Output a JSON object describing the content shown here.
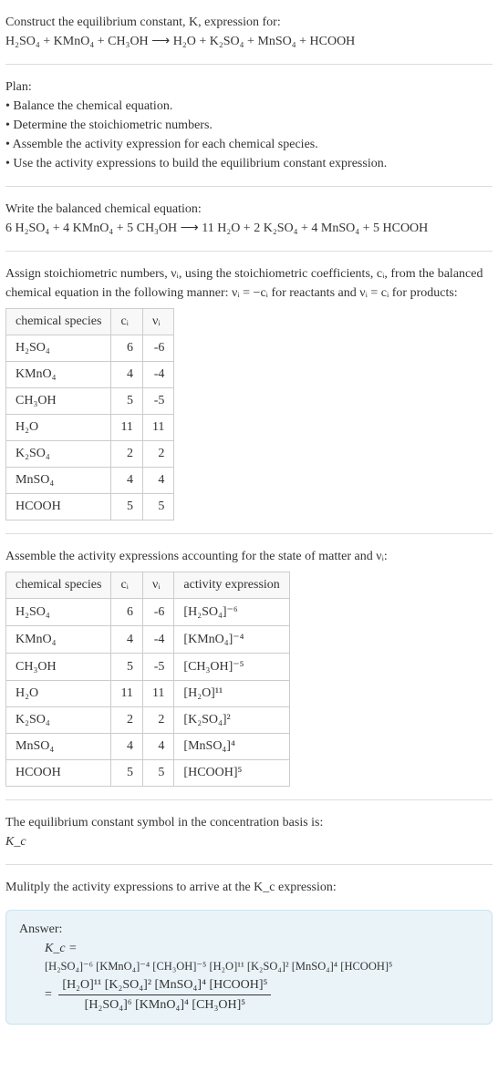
{
  "intro": {
    "prompt": "Construct the equilibrium constant, K, expression for:",
    "equation": "H₂SO₄ + KMnO₄ + CH₃OH ⟶ H₂O + K₂SO₄ + MnSO₄ + HCOOH"
  },
  "plan": {
    "heading": "Plan:",
    "bullets": [
      "• Balance the chemical equation.",
      "• Determine the stoichiometric numbers.",
      "• Assemble the activity expression for each chemical species.",
      "• Use the activity expressions to build the equilibrium constant expression."
    ]
  },
  "balanced": {
    "heading": "Write the balanced chemical equation:",
    "equation": "6 H₂SO₄ + 4 KMnO₄ + 5 CH₃OH ⟶ 11 H₂O + 2 K₂SO₄ + 4 MnSO₄ + 5 HCOOH"
  },
  "stoich": {
    "text1": "Assign stoichiometric numbers, νᵢ, using the stoichiometric coefficients, cᵢ, from the balanced chemical equation in the following manner: νᵢ = −cᵢ for reactants and νᵢ = cᵢ for products:",
    "headers": {
      "species": "chemical species",
      "ci": "cᵢ",
      "vi": "νᵢ"
    },
    "rows": [
      {
        "species": "H₂SO₄",
        "ci": "6",
        "vi": "-6"
      },
      {
        "species": "KMnO₄",
        "ci": "4",
        "vi": "-4"
      },
      {
        "species": "CH₃OH",
        "ci": "5",
        "vi": "-5"
      },
      {
        "species": "H₂O",
        "ci": "11",
        "vi": "11"
      },
      {
        "species": "K₂SO₄",
        "ci": "2",
        "vi": "2"
      },
      {
        "species": "MnSO₄",
        "ci": "4",
        "vi": "4"
      },
      {
        "species": "HCOOH",
        "ci": "5",
        "vi": "5"
      }
    ]
  },
  "activity": {
    "heading": "Assemble the activity expressions accounting for the state of matter and νᵢ:",
    "headers": {
      "species": "chemical species",
      "ci": "cᵢ",
      "vi": "νᵢ",
      "expr": "activity expression"
    },
    "rows": [
      {
        "species": "H₂SO₄",
        "ci": "6",
        "vi": "-6",
        "expr": "[H₂SO₄]⁻⁶"
      },
      {
        "species": "KMnO₄",
        "ci": "4",
        "vi": "-4",
        "expr": "[KMnO₄]⁻⁴"
      },
      {
        "species": "CH₃OH",
        "ci": "5",
        "vi": "-5",
        "expr": "[CH₃OH]⁻⁵"
      },
      {
        "species": "H₂O",
        "ci": "11",
        "vi": "11",
        "expr": "[H₂O]¹¹"
      },
      {
        "species": "K₂SO₄",
        "ci": "2",
        "vi": "2",
        "expr": "[K₂SO₄]²"
      },
      {
        "species": "MnSO₄",
        "ci": "4",
        "vi": "4",
        "expr": "[MnSO₄]⁴"
      },
      {
        "species": "HCOOH",
        "ci": "5",
        "vi": "5",
        "expr": "[HCOOH]⁵"
      }
    ]
  },
  "symbol": {
    "line1": "The equilibrium constant symbol in the concentration basis is:",
    "line2": "K_c"
  },
  "multiply": "Mulitply the activity expressions to arrive at the K_c expression:",
  "answer": {
    "label": "Answer:",
    "kc_eq": "K_c =",
    "line1": "[H₂SO₄]⁻⁶ [KMnO₄]⁻⁴ [CH₃OH]⁻⁵ [H₂O]¹¹ [K₂SO₄]² [MnSO₄]⁴ [HCOOH]⁵",
    "frac_num": "[H₂O]¹¹ [K₂SO₄]² [MnSO₄]⁴ [HCOOH]⁵",
    "frac_den": "[H₂SO₄]⁶ [KMnO₄]⁴ [CH₃OH]⁵"
  },
  "chart_data": {
    "type": "table",
    "tables": [
      {
        "title": "stoichiometric numbers",
        "columns": [
          "chemical species",
          "cᵢ",
          "νᵢ"
        ],
        "rows": [
          [
            "H₂SO₄",
            6,
            -6
          ],
          [
            "KMnO₄",
            4,
            -4
          ],
          [
            "CH₃OH",
            5,
            -5
          ],
          [
            "H₂O",
            11,
            11
          ],
          [
            "K₂SO₄",
            2,
            2
          ],
          [
            "MnSO₄",
            4,
            4
          ],
          [
            "HCOOH",
            5,
            5
          ]
        ]
      },
      {
        "title": "activity expressions",
        "columns": [
          "chemical species",
          "cᵢ",
          "νᵢ",
          "activity expression"
        ],
        "rows": [
          [
            "H₂SO₄",
            6,
            -6,
            "[H₂SO₄]^-6"
          ],
          [
            "KMnO₄",
            4,
            -4,
            "[KMnO₄]^-4"
          ],
          [
            "CH₃OH",
            5,
            -5,
            "[CH₃OH]^-5"
          ],
          [
            "H₂O",
            11,
            11,
            "[H₂O]^11"
          ],
          [
            "K₂SO₄",
            2,
            2,
            "[K₂SO₄]^2"
          ],
          [
            "MnSO₄",
            4,
            4,
            "[MnSO₄]^4"
          ],
          [
            "HCOOH",
            5,
            5,
            "[HCOOH]^5"
          ]
        ]
      }
    ]
  }
}
